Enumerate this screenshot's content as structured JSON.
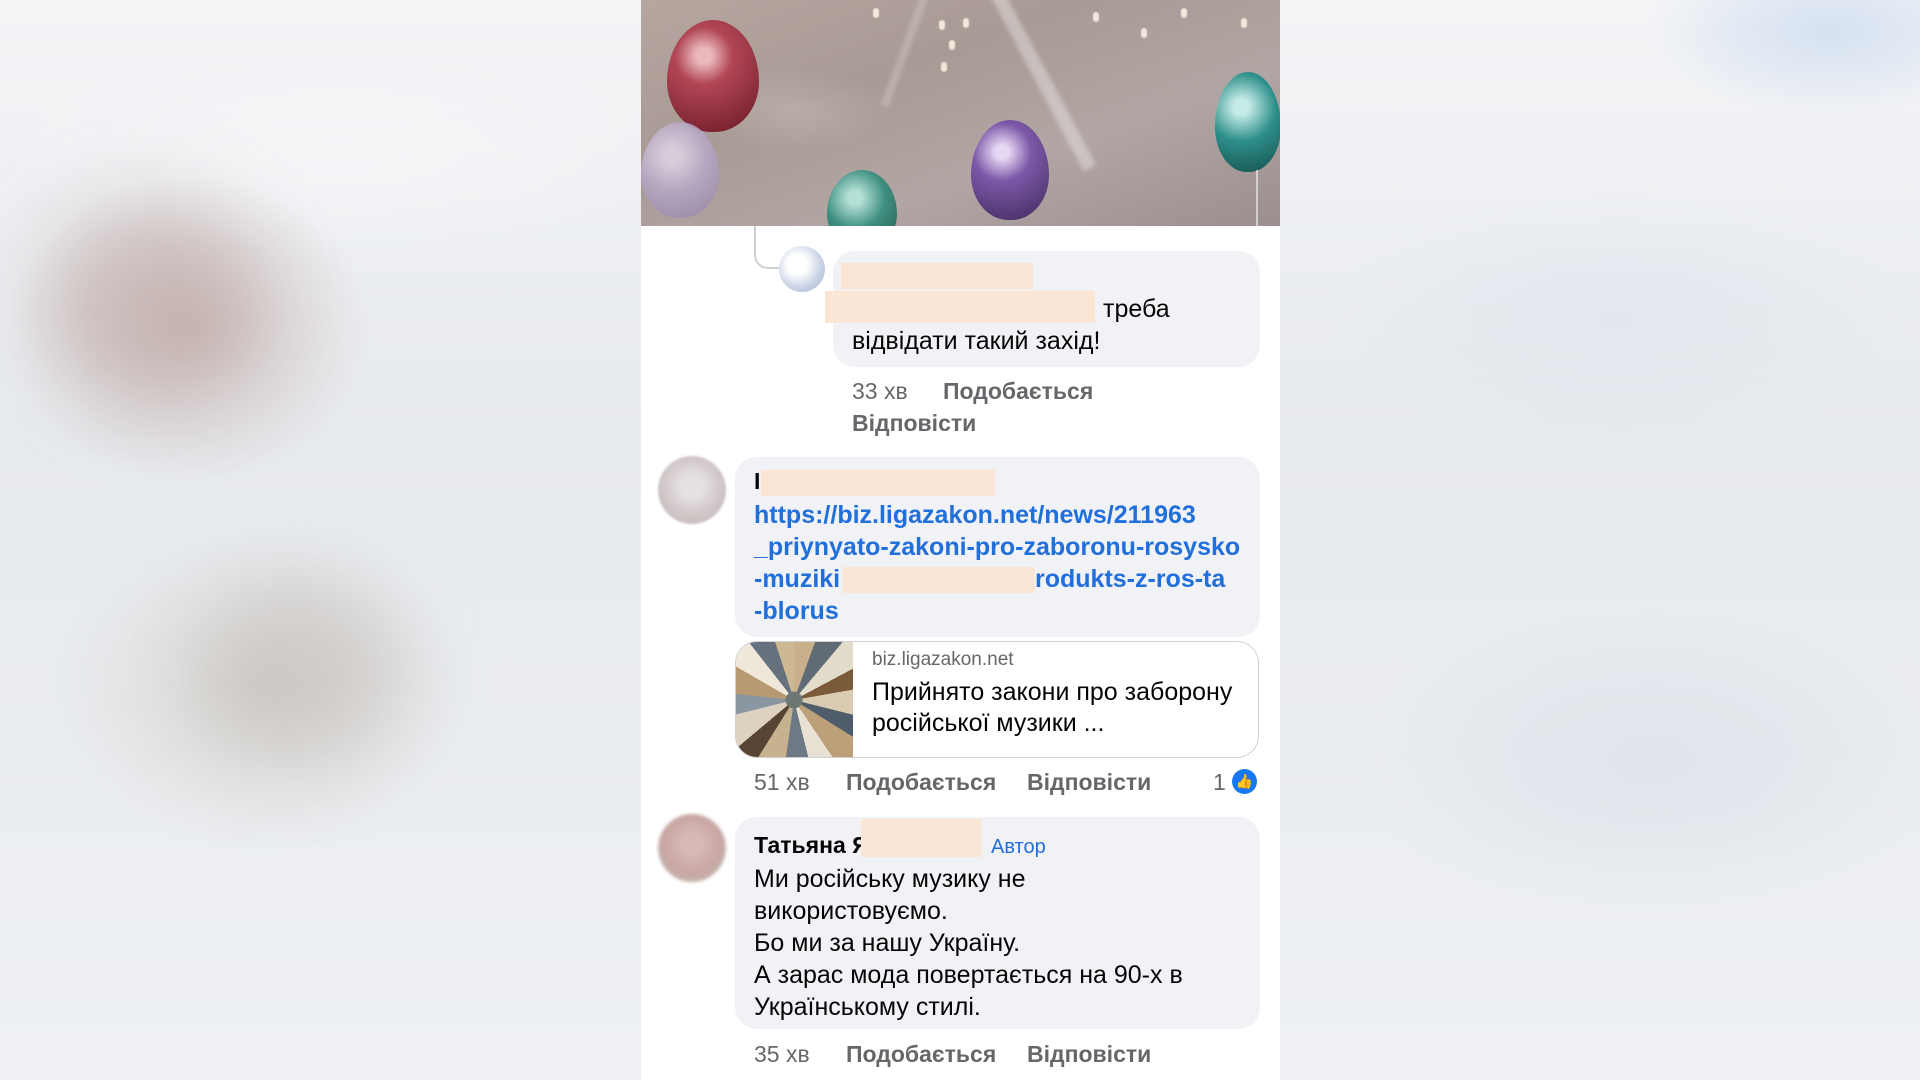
{
  "colors": {
    "link": "#216fdb",
    "bubble": "#f0f2f5",
    "meta_text": "#65676b",
    "like_badge": "#1877f2",
    "redaction": "#fbe6d5"
  },
  "comments": {
    "reply": {
      "text_line1": "треба",
      "text_line2": "відвідати такий захід!",
      "time": "33 хв",
      "like_label": "Подобається",
      "reply_label": "Відповісти"
    },
    "link_comment": {
      "prefix": "І",
      "link_part1": "https://biz.ligazakon.net/news/211963",
      "link_part2": "_priynyato-zakoni-pro-zaboronu-rosysko",
      "link_part3": "-muziki",
      "link_part4": "rodukts-z-ros-ta",
      "link_part5": "-blorus",
      "preview": {
        "domain": "biz.ligazakon.net",
        "title": "Прийнято закони про заборону російської музики ...",
        "thumb_icon": "books-icon"
      },
      "time": "51 хв",
      "like_label": "Подобається",
      "reply_label": "Відповісти",
      "like_count": "1",
      "like_icon": "thumbs-up-icon"
    },
    "author_comment": {
      "name": "Татьяна Я",
      "author_badge": "Автор",
      "line1": "Ми російську музику не",
      "line2": "використовуємо.",
      "line3": "Бо ми за нашу Україну.",
      "line4": "А зарас мода повертається на 90-х в",
      "line5": "Українському стилі.",
      "time": "35 хв",
      "like_label": "Подобається",
      "reply_label": "Відповісти"
    }
  }
}
